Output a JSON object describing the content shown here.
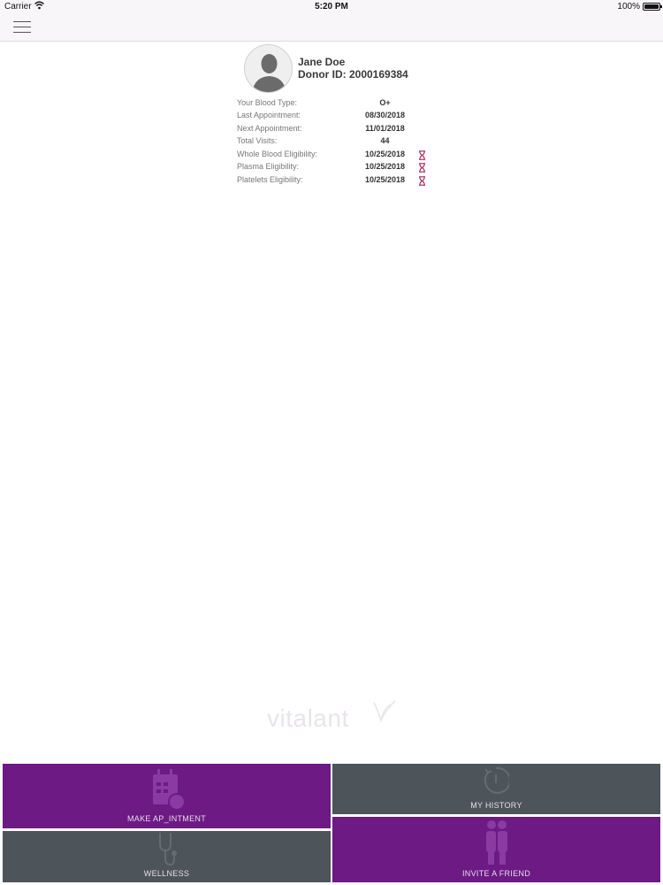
{
  "status_bar": {
    "carrier": "Carrier",
    "time": "5:20 PM",
    "battery": "100%"
  },
  "profile": {
    "name": "Jane Doe",
    "donor_id": "Donor ID: 2000169384"
  },
  "info_rows": [
    {
      "label": "Your Blood Type:",
      "value": "O+"
    },
    {
      "label": "Last Appointment:",
      "value": "08/30/2018"
    },
    {
      "label": "Next Appointment:",
      "value": "11/01/2018"
    },
    {
      "label": "Total Visits:",
      "value": "44"
    },
    {
      "label": "Whole Blood Eligibility:",
      "value": "10/25/2018"
    },
    {
      "label": "Plasma Eligibility:",
      "value": "10/25/2018"
    },
    {
      "label": "Platelets Eligibility:",
      "value": "10/25/2018"
    }
  ],
  "logo": {
    "text": "vitalant"
  },
  "tiles": {
    "make_appointment": "MAKE AP_INTMENT",
    "my_history": "MY HISTORY",
    "wellness": "WELLNESS",
    "invite_friend": "INVITE A FRIEND"
  },
  "icons": {
    "menu": "hamburger-icon",
    "eligibility": "hourglass-icon"
  },
  "colors": {
    "brand_purple": "#6d1a85",
    "tile_gray": "#4d555b",
    "hourglass": "#a0244e"
  }
}
